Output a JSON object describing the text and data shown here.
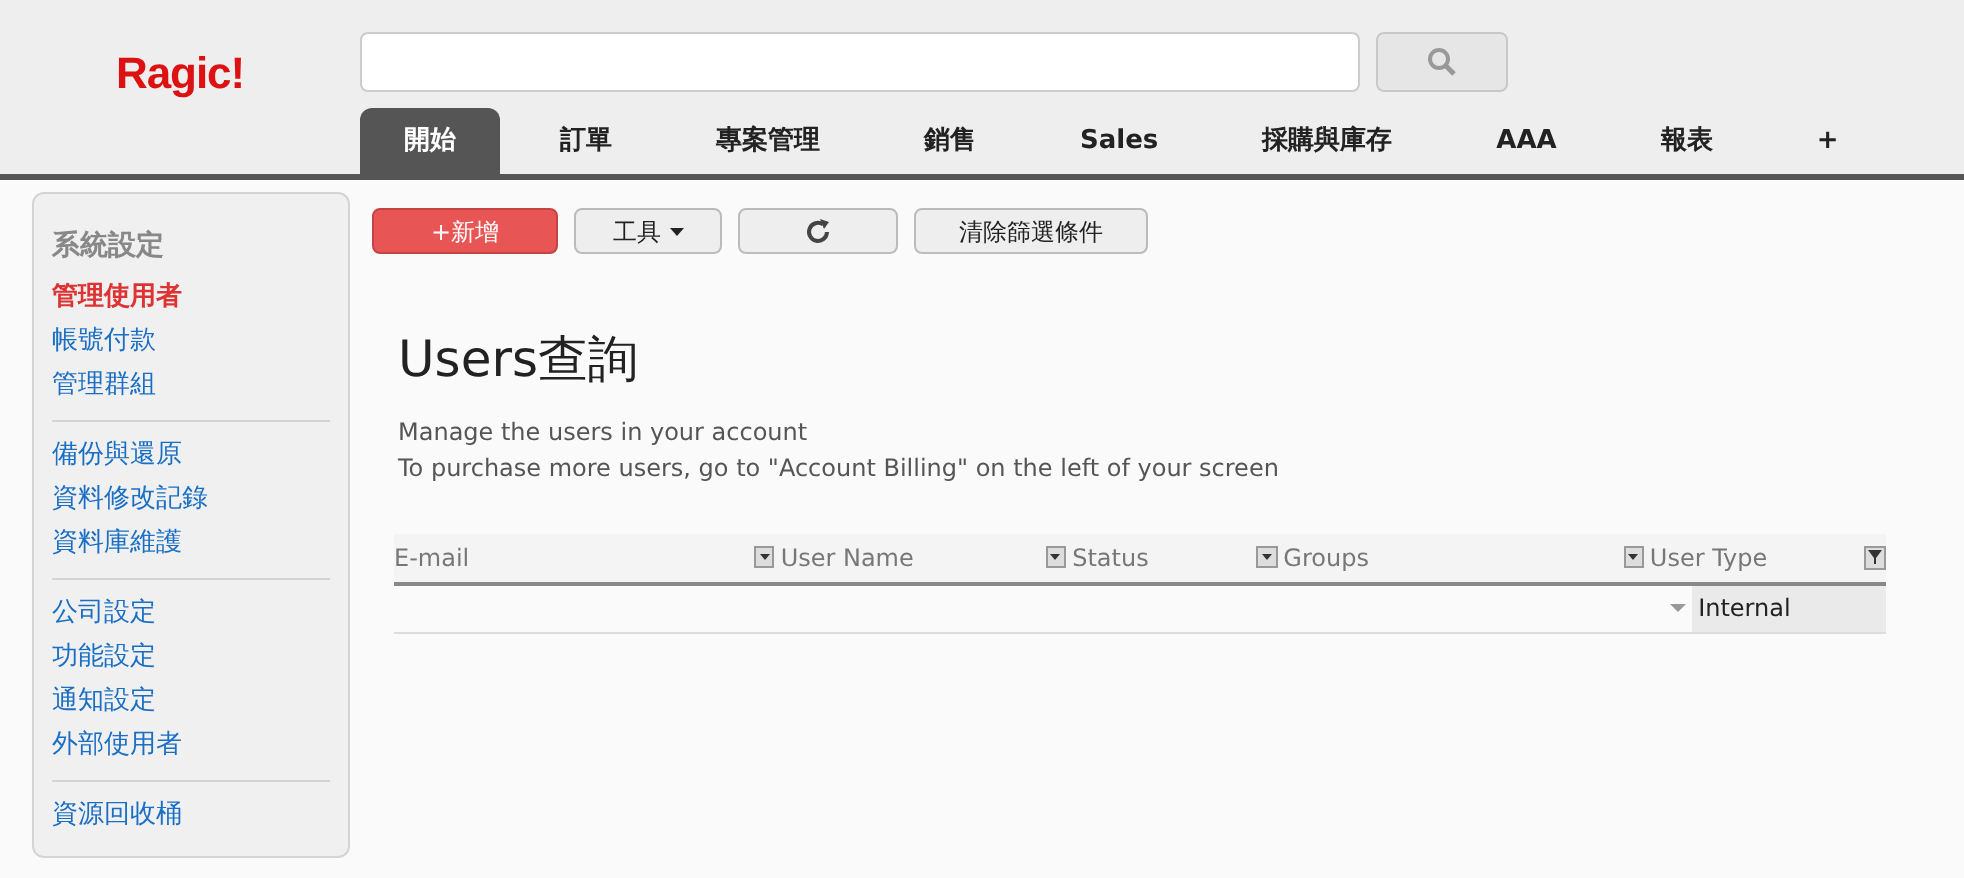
{
  "logo": "Ragic!",
  "tabs": [
    {
      "label": "開始",
      "selected": true
    },
    {
      "label": "訂單",
      "selected": false
    },
    {
      "label": "專案管理",
      "selected": false
    },
    {
      "label": "銷售",
      "selected": false
    },
    {
      "label": "Sales",
      "selected": false
    },
    {
      "label": "採購與庫存",
      "selected": false
    },
    {
      "label": "AAA",
      "selected": false
    },
    {
      "label": "報表",
      "selected": false
    },
    {
      "label": "+",
      "selected": false
    }
  ],
  "sidebar": {
    "title": "系統設定",
    "groups": [
      [
        {
          "label": "管理使用者",
          "selected": true
        },
        {
          "label": "帳號付款",
          "selected": false
        },
        {
          "label": "管理群組",
          "selected": false
        }
      ],
      [
        {
          "label": "備份與還原",
          "selected": false
        },
        {
          "label": "資料修改記錄",
          "selected": false
        },
        {
          "label": "資料庫維護",
          "selected": false
        }
      ],
      [
        {
          "label": "公司設定",
          "selected": false
        },
        {
          "label": "功能設定",
          "selected": false
        },
        {
          "label": "通知設定",
          "selected": false
        },
        {
          "label": "外部使用者",
          "selected": false
        }
      ],
      [
        {
          "label": "資源回收桶",
          "selected": false
        }
      ]
    ]
  },
  "toolbar": [
    {
      "kind": "primary",
      "label": "+新增"
    },
    {
      "kind": "menu",
      "label": "工具"
    },
    {
      "kind": "refresh"
    },
    {
      "kind": "plain",
      "label": "清除篩選條件"
    }
  ],
  "heading": "Users查詢",
  "description": [
    "Manage the users in your account",
    "To purchase more users, go to \"Account Billing\" on the left of your screen"
  ],
  "table": {
    "columns": [
      "E-mail",
      "User Name",
      "Status",
      "Groups",
      "User Type"
    ],
    "rows": [
      {
        "user_type": "Internal"
      }
    ]
  }
}
